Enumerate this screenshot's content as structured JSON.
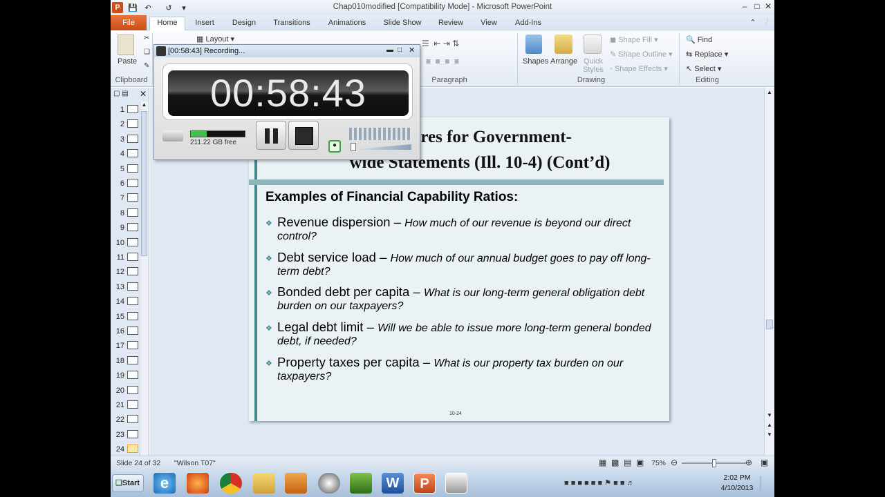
{
  "window": {
    "title": "Chap010modified [Compatibility Mode]  -  Microsoft PowerPoint",
    "tabs": [
      "File",
      "Home",
      "Insert",
      "Design",
      "Transitions",
      "Animations",
      "Slide Show",
      "Review",
      "View",
      "Add-Ins"
    ],
    "active_tab": "Home"
  },
  "ribbon": {
    "paste_label": "Paste",
    "layout_label": "Layout",
    "clipboard_group": "Clipboard",
    "paragraph_group": "Paragraph",
    "drawing_group": "Drawing",
    "editing_group": "Editing",
    "shapes_label": "Shapes",
    "arrange_label": "Arrange",
    "quick_styles_label": "Quick Styles",
    "shape_fill": "Shape Fill",
    "shape_outline": "Shape Outline",
    "shape_effects": "Shape Effects",
    "find": "Find",
    "replace": "Replace",
    "select": "Select"
  },
  "thumbnails": [
    "1",
    "2",
    "3",
    "4",
    "5",
    "6",
    "7",
    "8",
    "9",
    "10",
    "11",
    "12",
    "13",
    "14",
    "15",
    "16",
    "17",
    "18",
    "19",
    "20",
    "21",
    "22",
    "23",
    "24"
  ],
  "selected_slide": "24",
  "slide": {
    "title_line1": "easures for Government-",
    "title_line2": "wide Statements (Ill. 10-4) (Cont’d)",
    "subtitle": "Examples of Financial Capability Ratios:",
    "bullets": [
      {
        "main": "Revenue dispersion – ",
        "italic": "How much of our revenue is beyond our direct control?"
      },
      {
        "main": "Debt service load – ",
        "italic": "How much of our annual budget goes to pay off long-term debt?"
      },
      {
        "main": "Bonded debt per capita – ",
        "italic": "What is our long-term general obligation debt burden on our taxpayers?"
      },
      {
        "main": "Legal debt limit – ",
        "italic": "Will we be able to issue more long-term general bonded debt, if needed?"
      },
      {
        "main": "Property taxes per capita – ",
        "italic": "What is our property tax burden on our taxpayers?"
      }
    ],
    "page_number": "10-24"
  },
  "status": {
    "slide_info": "Slide 24 of 32",
    "theme": "\"Wilson T07\"",
    "zoom": "75%",
    "zoom_level": 0.5
  },
  "recorder": {
    "title": "[00:58:43] Recording...",
    "time": "00:58:43",
    "disk_free": "211.22 GB free",
    "disk_used_fraction": 0.3
  },
  "taskbar": {
    "start": "Start",
    "clock_time": "2:02 PM",
    "clock_date": "4/10/2013"
  },
  "colors": {
    "file_tab": "#d65a1f",
    "accent": "#3f8b8e"
  }
}
